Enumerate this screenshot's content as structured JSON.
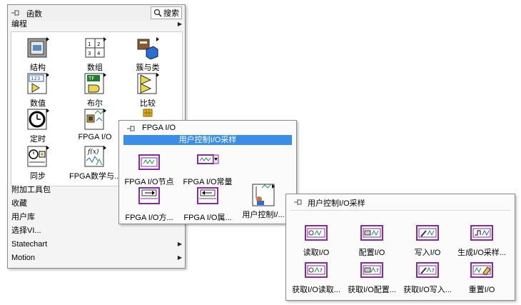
{
  "main": {
    "title": "函数",
    "search_label": "搜索",
    "category_top": "编程",
    "items": [
      {
        "label": "结构",
        "icon": "structures-icon"
      },
      {
        "label": "数组",
        "icon": "array-icon"
      },
      {
        "label": "簇与类",
        "icon": "cluster-class-icon"
      },
      {
        "label": "数值",
        "icon": "numeric-icon"
      },
      {
        "label": "布尔",
        "icon": "boolean-icon"
      },
      {
        "label": "比较",
        "icon": "comparison-icon"
      },
      {
        "label": "定时",
        "icon": "timing-icon"
      },
      {
        "label": "FPGA I/O",
        "icon": "fpga-io-icon"
      },
      {
        "label": "",
        "icon": "grid-icon"
      },
      {
        "label": "同步",
        "icon": "synchronization-icon"
      },
      {
        "label": "FPGA数学与...",
        "icon": "fpga-math-icon"
      }
    ],
    "categories": [
      {
        "label": "附加工具包",
        "arrow": false
      },
      {
        "label": "收藏",
        "arrow": false
      },
      {
        "label": "用户库",
        "arrow": false
      },
      {
        "label": "选择VI...",
        "arrow": false
      },
      {
        "label": "Statechart",
        "arrow": true
      },
      {
        "label": "Motion",
        "arrow": true
      }
    ]
  },
  "fpga_palette": {
    "title": "FPGA I/O",
    "highlight": "用户控制I/O采样",
    "items": [
      {
        "label": "FPGA I/O节点",
        "icon": "fpga-io-node-icon"
      },
      {
        "label": "FPGA I/O常量",
        "icon": "fpga-io-constant-icon"
      },
      {
        "label": "FPGA I/O方...",
        "icon": "fpga-io-method-icon"
      },
      {
        "label": "FPGA I/O属...",
        "icon": "fpga-io-property-icon"
      },
      {
        "label": "用户控制I/...",
        "icon": "user-controlled-io-icon"
      }
    ]
  },
  "uc_palette": {
    "title": "用户控制I/O采样",
    "items": [
      {
        "label": "读取I/O",
        "icon": "read-io-icon"
      },
      {
        "label": "配置I/O",
        "icon": "configure-io-icon"
      },
      {
        "label": "写入I/O",
        "icon": "write-io-icon"
      },
      {
        "label": "生成I/O采样...",
        "icon": "generate-io-sample-icon"
      },
      {
        "label": "获取I/O读取...",
        "icon": "get-io-read-icon"
      },
      {
        "label": "获取I/O配置...",
        "icon": "get-io-config-icon"
      },
      {
        "label": "获取I/O写入...",
        "icon": "get-io-write-icon"
      },
      {
        "label": "重置I/O",
        "icon": "reset-io-icon"
      }
    ]
  }
}
